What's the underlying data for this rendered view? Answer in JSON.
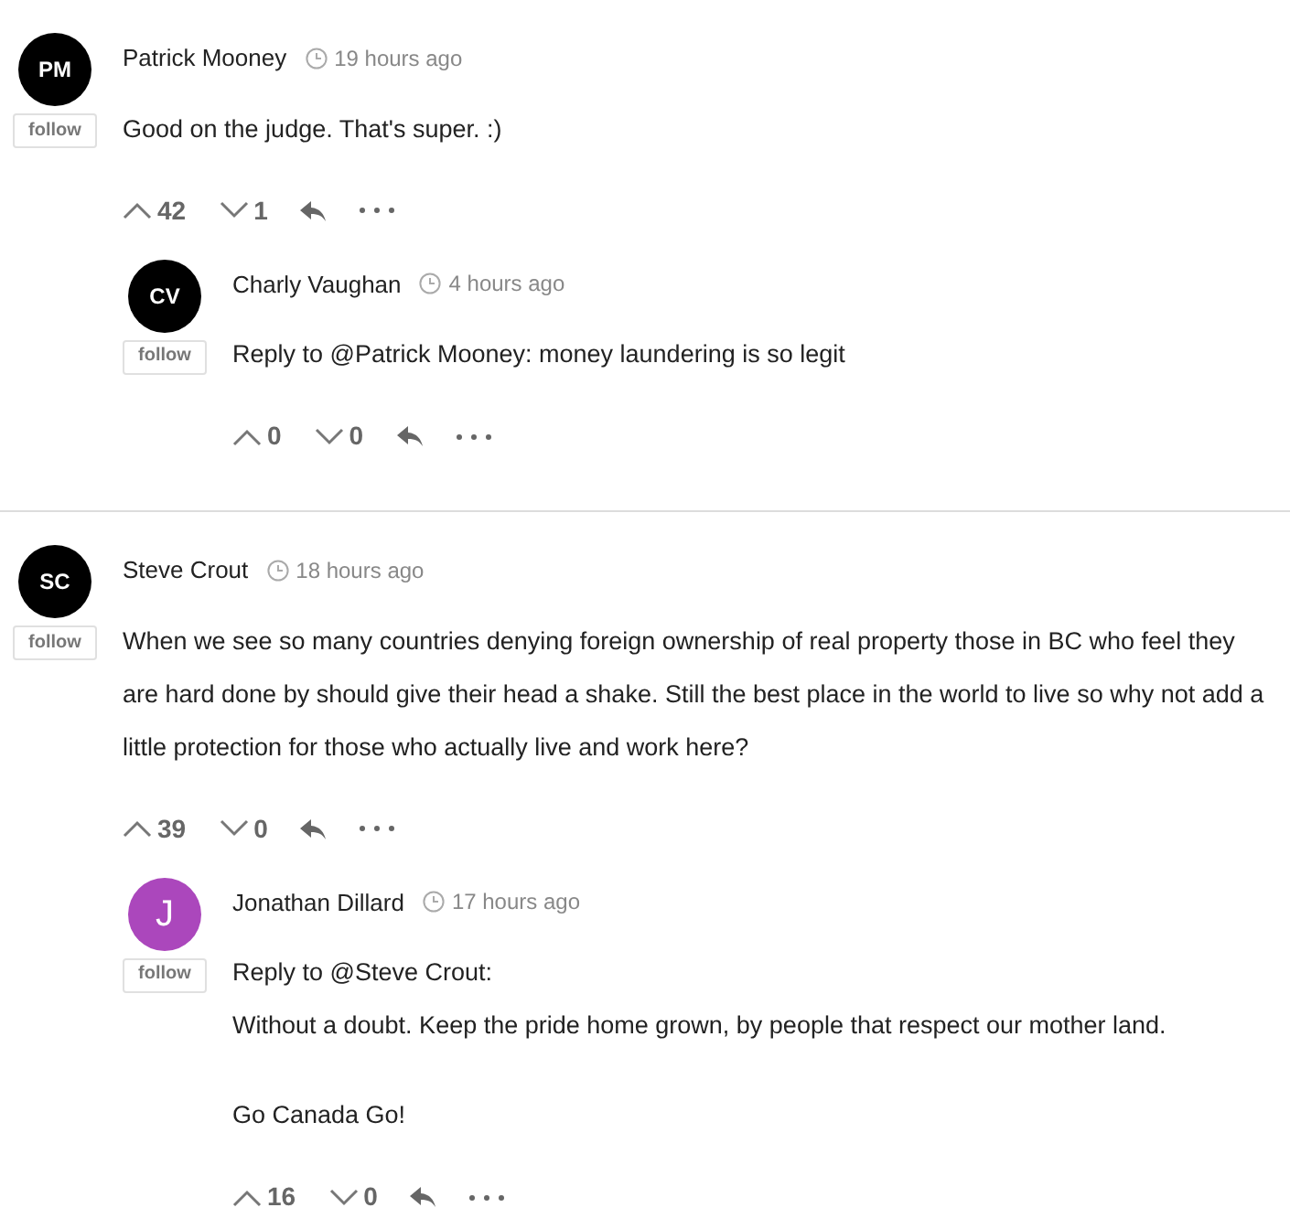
{
  "comments": [
    {
      "initials": "PM",
      "color": "#000000",
      "author": "Patrick Mooney",
      "time": "19 hours ago",
      "follow": "follow",
      "body": [
        "Good on the judge. That's super. :)"
      ],
      "up": "42",
      "down": "1",
      "replies": [
        {
          "initials": "CV",
          "color": "#000000",
          "author": "Charly Vaughan",
          "time": "4 hours ago",
          "follow": "follow",
          "body": [
            "Reply to @Patrick Mooney: money laundering is so legit"
          ],
          "up": "0",
          "down": "0"
        }
      ]
    },
    {
      "initials": "SC",
      "color": "#000000",
      "author": "Steve Crout",
      "time": "18 hours ago",
      "follow": "follow",
      "body": [
        "When we see so many countries denying foreign ownership of real property those in BC who feel they are hard done by should give their head a shake. Still the best place in the world to live so why not add a little protection for those who actually live and work here?"
      ],
      "up": "39",
      "down": "0",
      "replies": [
        {
          "initials": "J",
          "color": "#ab47bc",
          "author": "Jonathan Dillard",
          "time": "17 hours ago",
          "follow": "follow",
          "body": [
            "Reply to @Steve Crout:\nWithout a doubt. Keep the pride home grown, by people that respect our mother land.",
            "Go Canada Go!"
          ],
          "up": "16",
          "down": "0"
        }
      ]
    }
  ]
}
